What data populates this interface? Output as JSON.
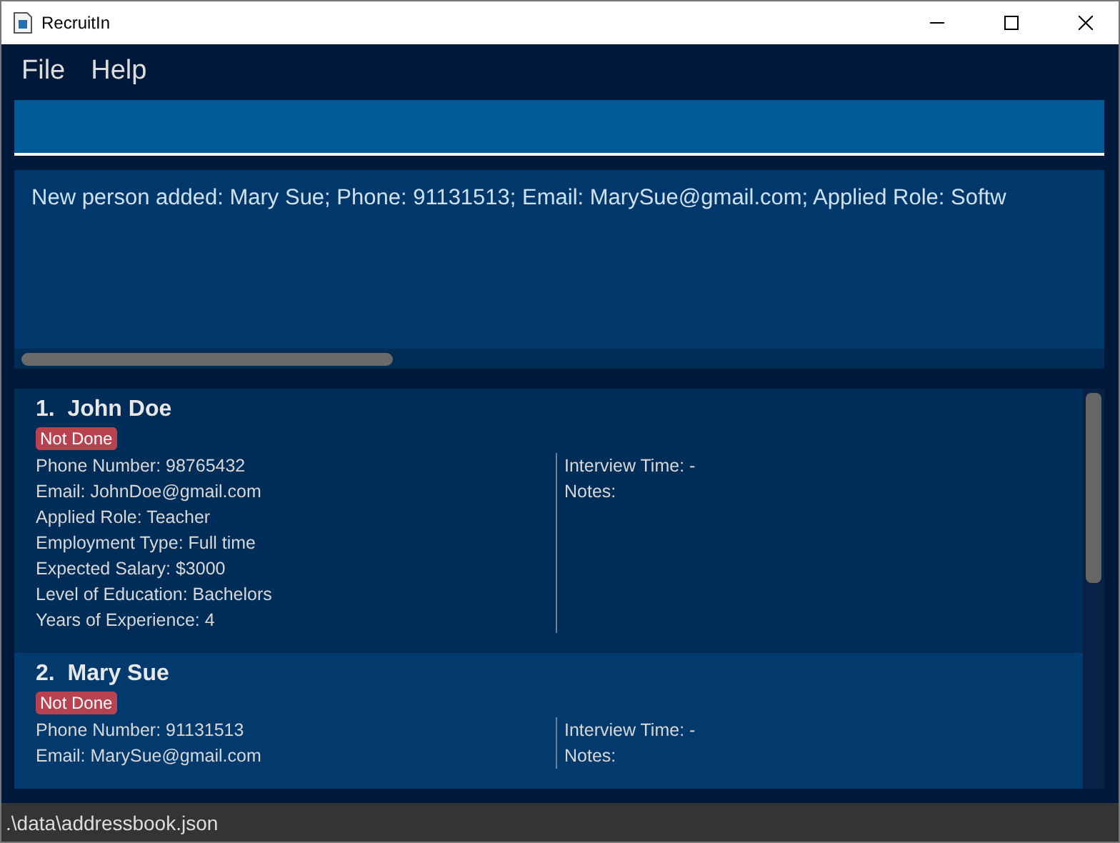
{
  "window": {
    "title": "RecruitIn"
  },
  "menu": [
    "File",
    "Help"
  ],
  "result": "New person added: Mary Sue; Phone: 91131513; Email: MarySue@gmail.com; Applied Role: Softw",
  "persons": [
    {
      "index": "1.",
      "name": "John Doe",
      "status": "Not Done",
      "details": [
        "Phone Number: 98765432",
        "Email: JohnDoe@gmail.com",
        "Applied Role: Teacher",
        "Employment Type: Full time",
        "Expected Salary: $3000",
        "Level of Education: Bachelors",
        "Years of Experience: 4"
      ],
      "side": [
        "Interview Time: -",
        "Notes:"
      ]
    },
    {
      "index": "2.",
      "name": "Mary Sue",
      "status": "Not Done",
      "details": [
        "Phone Number: 91131513",
        "Email: MarySue@gmail.com"
      ],
      "side": [
        "Interview Time: -",
        "Notes:"
      ]
    }
  ],
  "status_bar": ".\\data\\addressbook.json"
}
